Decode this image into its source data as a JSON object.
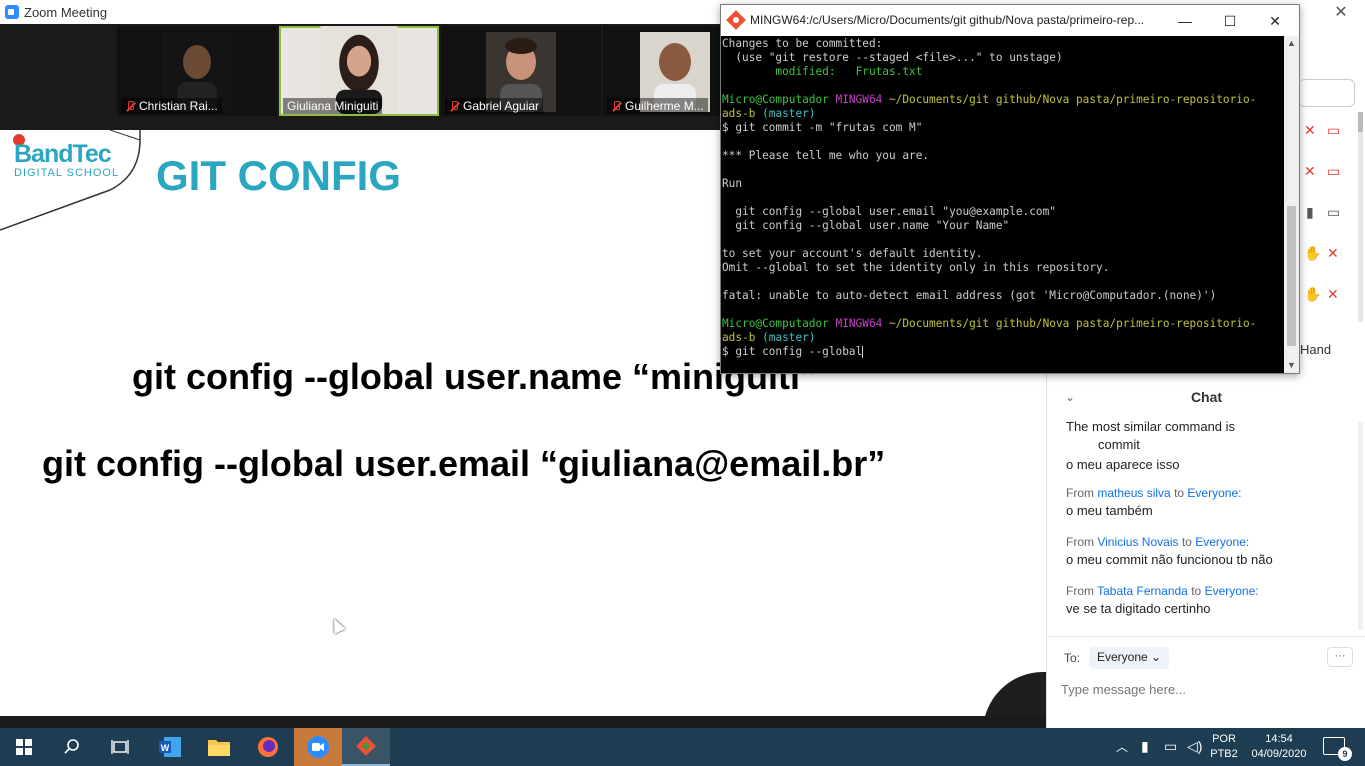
{
  "zoom": {
    "window_title": "Zoom Meeting",
    "close_glyph": "✕"
  },
  "video_tiles": [
    {
      "name": "Christian Rai...",
      "muted": true
    },
    {
      "name": "Giuliana Miniguiti",
      "muted": false
    },
    {
      "name": "Gabriel Aguiar",
      "muted": true
    },
    {
      "name": "Guilherme M...",
      "muted": true
    }
  ],
  "slide": {
    "logo_brand": "BandTec",
    "logo_sub": "DIGITAL SCHOOL",
    "heading": "GIT CONFIG",
    "line1": "git config --global user.name “miniguiti”",
    "line2": "git config --global user.email “giuliana@email.br”"
  },
  "terminal": {
    "title": "MINGW64:/c/Users/Micro/Documents/git github/Nova pasta/primeiro-rep...",
    "lines": [
      [
        {
          "t": "Changes to be committed:",
          "c": ""
        }
      ],
      [
        {
          "t": "  (use \"git restore --staged <file>...\" to unstage)",
          "c": ""
        }
      ],
      [
        {
          "t": "        modified:   Frutas.txt",
          "c": "green"
        }
      ],
      [
        {
          "t": "",
          "c": ""
        }
      ],
      [
        {
          "t": "Micro@Computador ",
          "c": "green"
        },
        {
          "t": "MINGW64 ",
          "c": "magenta"
        },
        {
          "t": "~/Documents/git github/Nova pasta/primeiro-repositorio-",
          "c": "yellow"
        }
      ],
      [
        {
          "t": "ads-b",
          "c": "yellow"
        },
        {
          "t": " (master)",
          "c": "cyan"
        }
      ],
      [
        {
          "t": "$ git commit -m \"frutas com M\"",
          "c": ""
        }
      ],
      [
        {
          "t": "",
          "c": ""
        }
      ],
      [
        {
          "t": "*** Please tell me who you are.",
          "c": ""
        }
      ],
      [
        {
          "t": "",
          "c": ""
        }
      ],
      [
        {
          "t": "Run",
          "c": ""
        }
      ],
      [
        {
          "t": "",
          "c": ""
        }
      ],
      [
        {
          "t": "  git config --global user.email \"you@example.com\"",
          "c": ""
        }
      ],
      [
        {
          "t": "  git config --global user.name \"Your Name\"",
          "c": ""
        }
      ],
      [
        {
          "t": "",
          "c": ""
        }
      ],
      [
        {
          "t": "to set your account's default identity.",
          "c": ""
        }
      ],
      [
        {
          "t": "Omit --global to set the identity only in this repository.",
          "c": ""
        }
      ],
      [
        {
          "t": "",
          "c": ""
        }
      ],
      [
        {
          "t": "fatal: unable to auto-detect email address (got 'Micro@Computador.(none)')",
          "c": ""
        }
      ],
      [
        {
          "t": "",
          "c": ""
        }
      ],
      [
        {
          "t": "Micro@Computador ",
          "c": "green"
        },
        {
          "t": "MINGW64 ",
          "c": "magenta"
        },
        {
          "t": "~/Documents/git github/Nova pasta/primeiro-repositorio-",
          "c": "yellow"
        }
      ],
      [
        {
          "t": "ads-b",
          "c": "yellow"
        },
        {
          "t": " (master)",
          "c": "cyan"
        }
      ],
      [
        {
          "t": "$ git config --global",
          "c": ""
        }
      ]
    ]
  },
  "participants": {
    "hand_label": "Hand"
  },
  "chat": {
    "title": "Chat",
    "messages": [
      {
        "from": "",
        "to": "",
        "text": "The most similar command is",
        "text2": "commit"
      },
      {
        "from": "",
        "to": "",
        "text": "o meu aparece isso"
      },
      {
        "from": "matheus silva",
        "to": "Everyone:",
        "text": "o meu também"
      },
      {
        "from": "Vinicius Novais",
        "to": "Everyone:",
        "text": "o meu commit não funcionou tb não"
      },
      {
        "from": "Tabata Fernanda",
        "to": "Everyone:",
        "text": "ve se ta digitado certinho"
      }
    ],
    "from_word": "From",
    "to_word": "to",
    "to_label": "To:",
    "recipient": "Everyone",
    "more": "···",
    "input_placeholder": "Type message here..."
  },
  "taskbar": {
    "lang_line1": "POR",
    "lang_line2": "PTB2",
    "time": "14:54",
    "date": "04/09/2020",
    "notifications": "9"
  },
  "colors": {
    "accent": "#2aa6c0",
    "zoom_blue": "#0e71eb",
    "taskbar": "#1f3d52"
  }
}
